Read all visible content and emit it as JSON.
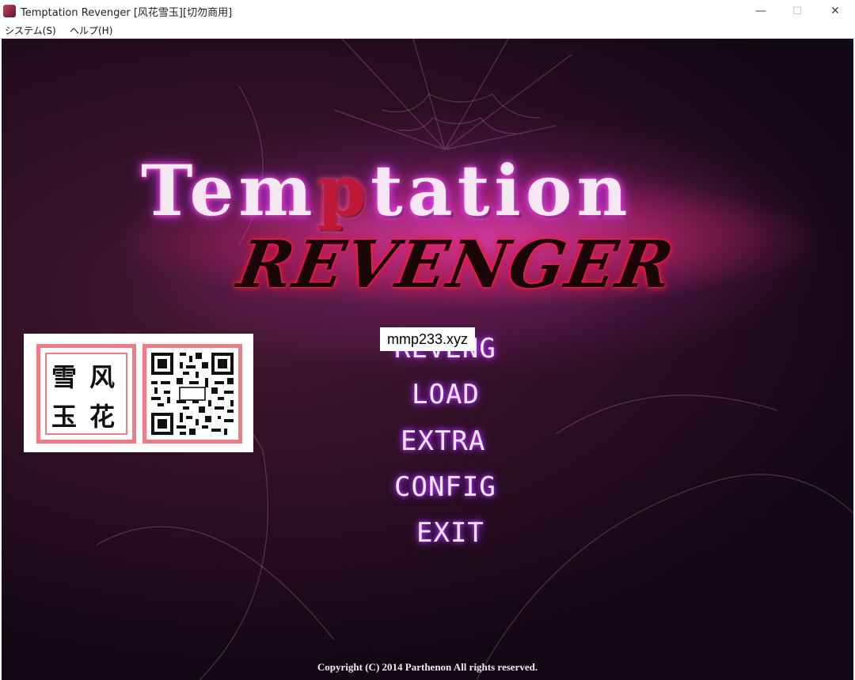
{
  "window": {
    "title": "Temptation Revenger [风花雪玉][切勿商用]",
    "minimize": "—",
    "maximize": "☐",
    "close": "✕"
  },
  "menubar": {
    "items": [
      {
        "label": "システム(S)"
      },
      {
        "label": "ヘルプ(H)"
      }
    ]
  },
  "game": {
    "logo_line1_pre": "Tem",
    "logo_line1_accent": "p",
    "logo_line1_post": "tation",
    "logo_line2": "REVENGER",
    "menu": [
      {
        "label": "REVENG"
      },
      {
        "label": "LOAD"
      },
      {
        "label": "EXTRA"
      },
      {
        "label": "CONFIG"
      },
      {
        "label": "EXIT"
      }
    ],
    "copyright": "Copyright (C)  2014  Parthenon All rights reserved."
  },
  "overlay": {
    "watermark": "mmp233.xyz",
    "seal_chars": [
      "雪",
      "风",
      "玉",
      "花"
    ]
  },
  "colors": {
    "menu_glow": "#c040ff",
    "logo_accent": "#c01838",
    "seal_border": "#f07a86"
  }
}
